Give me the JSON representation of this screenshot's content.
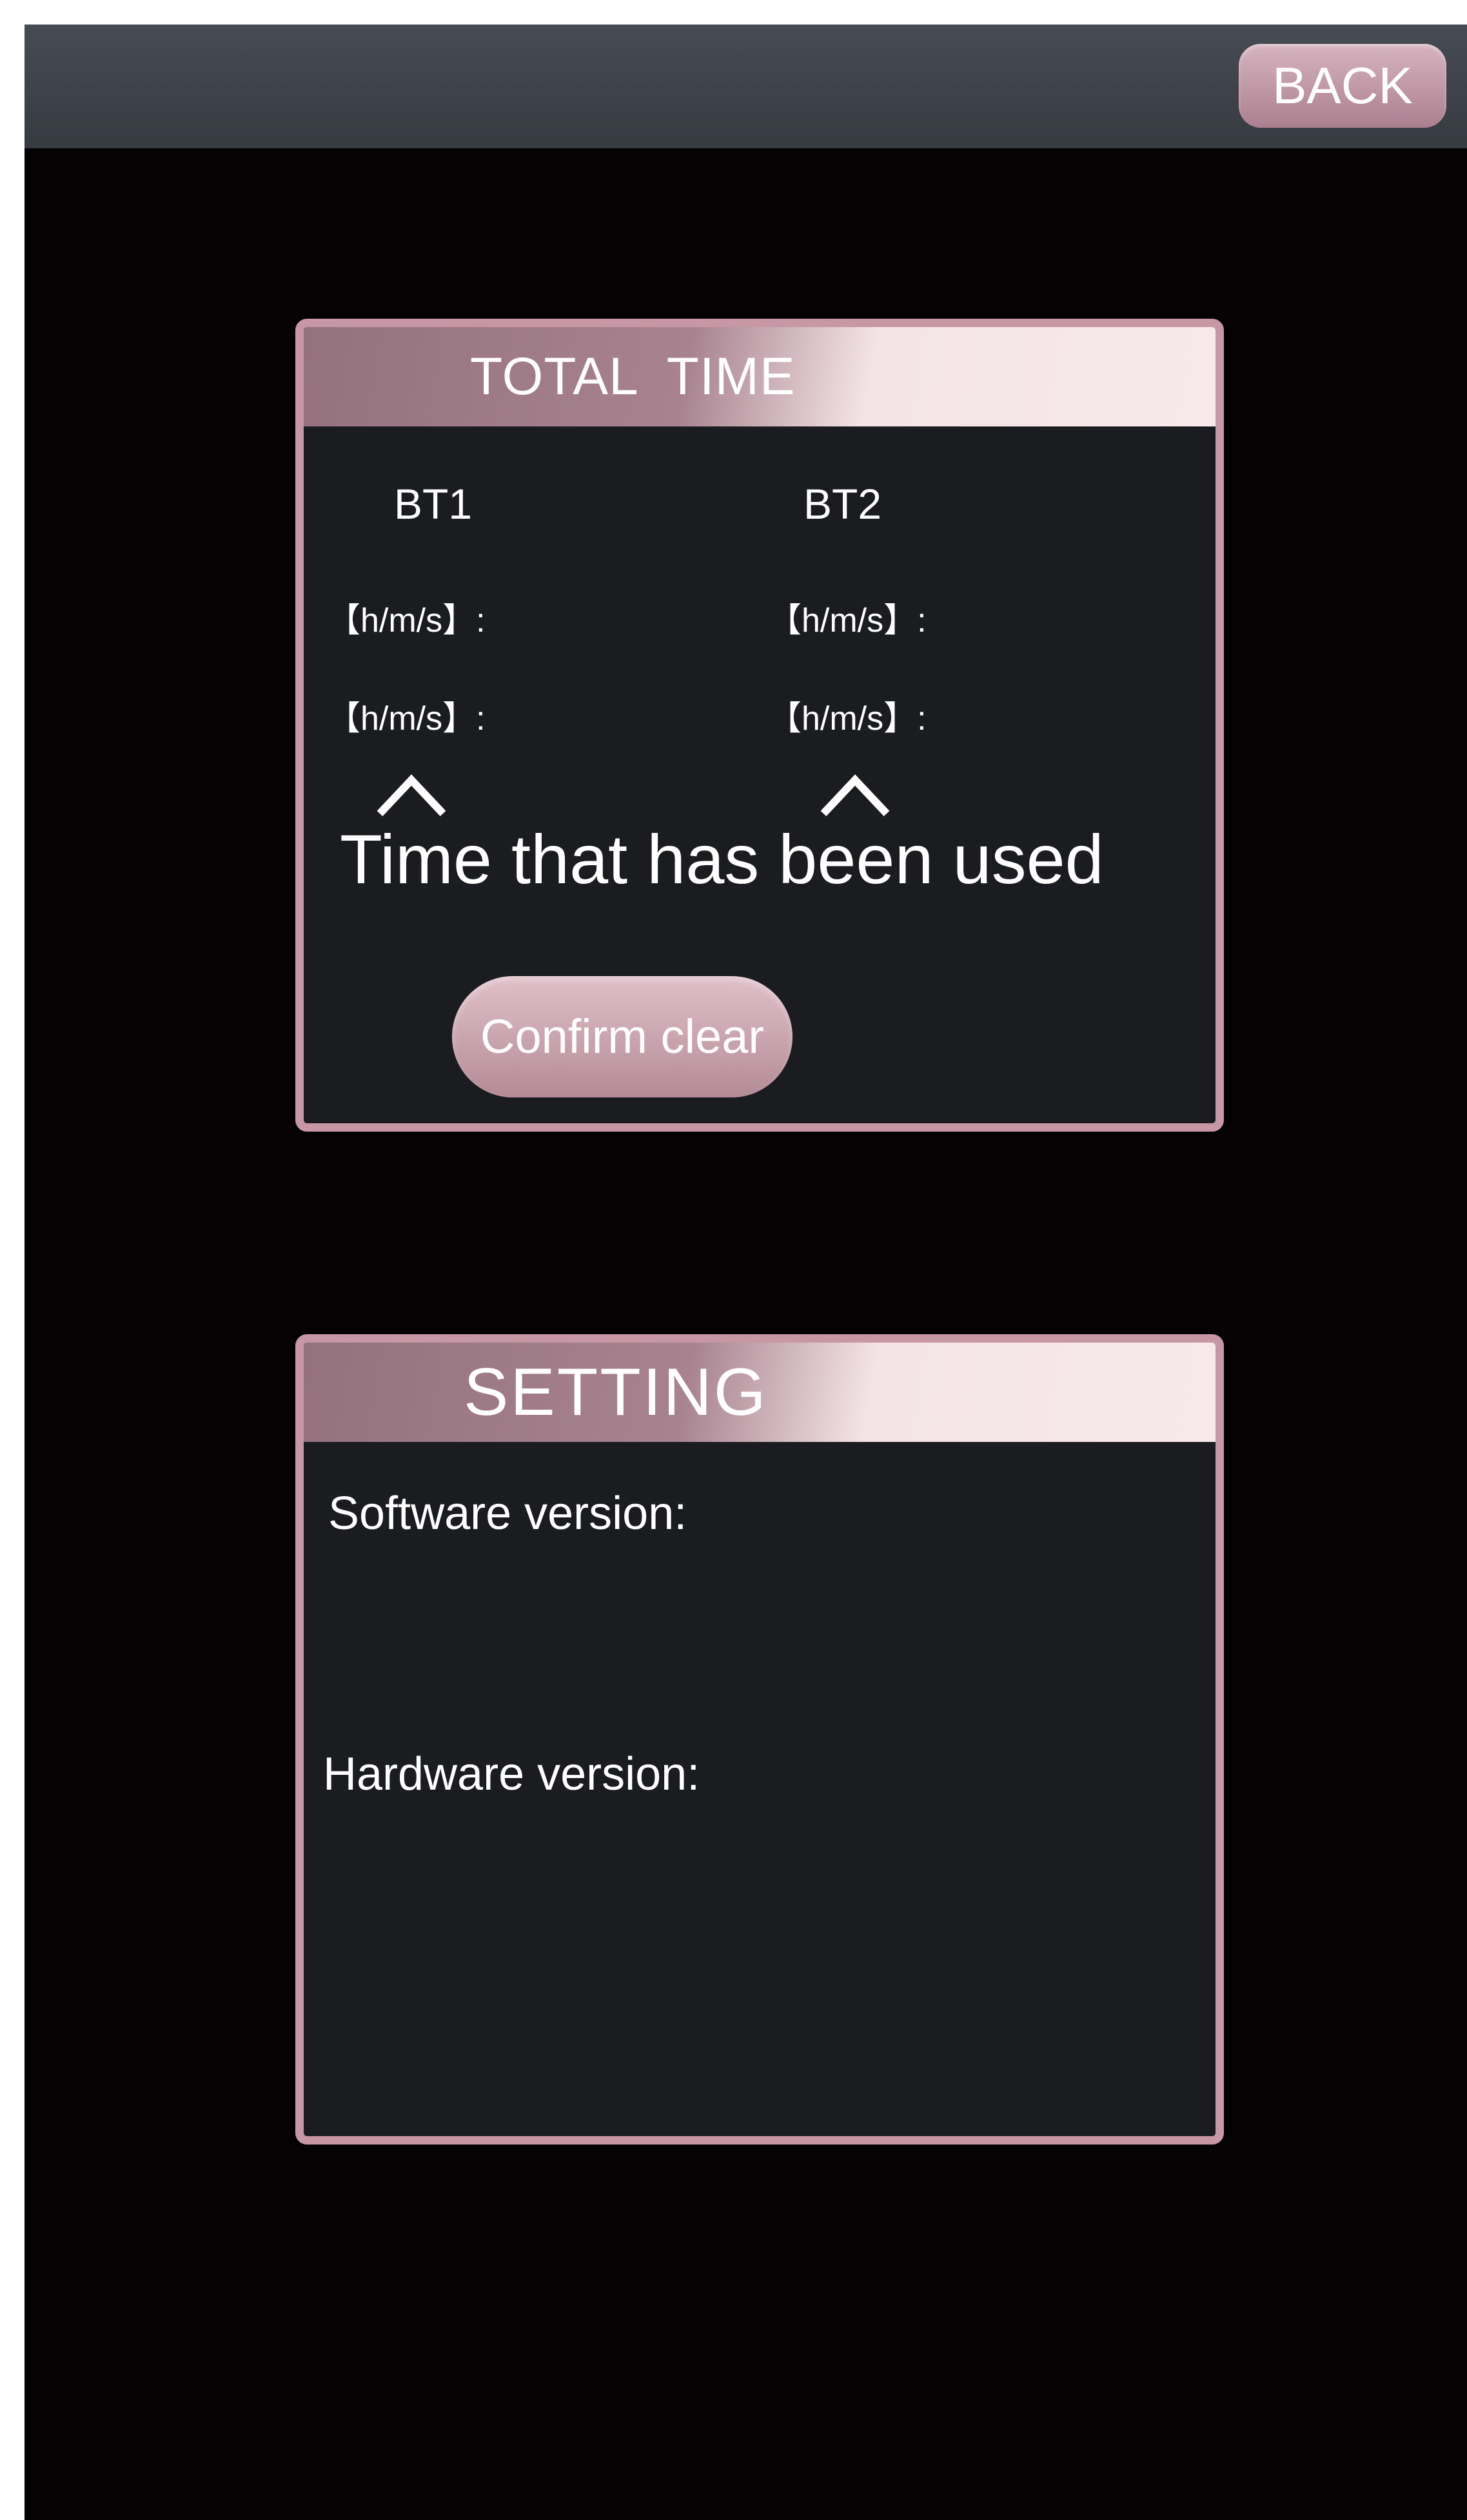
{
  "topbar": {
    "back_label": "BACK"
  },
  "total_time": {
    "title": "TOTAL  TIME",
    "bt1_label": "BT1",
    "bt2_label": "BT2",
    "unit_label": "【h/m/s】:",
    "used_note": "Time that has been used",
    "confirm_label": "Confirm clear"
  },
  "setting": {
    "title": "SETTING",
    "software_label": "Software version:",
    "hardware_label": "Hardware version:"
  },
  "colors": {
    "accent": "#c797a6",
    "panel_background": "#1b1c1f",
    "screen_background": "#050203",
    "topbar": "#3d4148"
  }
}
